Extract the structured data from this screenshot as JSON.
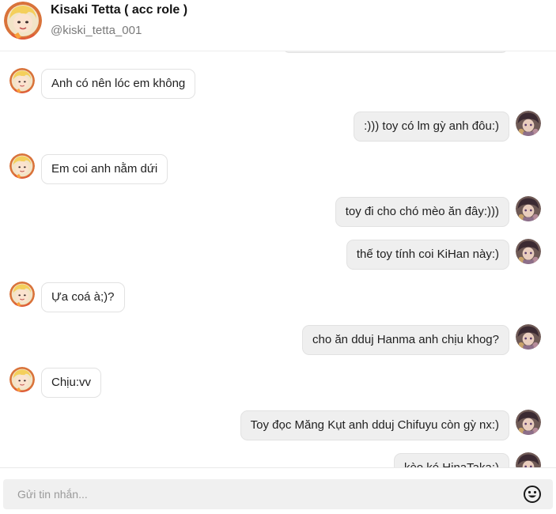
{
  "header": {
    "name": "Kisaki Tetta ( acc role )",
    "handle": "@kiski_tetta_001"
  },
  "composer": {
    "placeholder": "Gửi tin nhắn..."
  },
  "colors": {
    "incoming_bubble": "#ffffff",
    "outgoing_bubble": "#efefef",
    "bubble_border": "#e2e2e2",
    "composer_field": "#f0f0f0"
  },
  "icons": {
    "contact_avatar": "blonde-character-avatar",
    "user_avatar": "character-avatar",
    "emoji_button": "smiley-face-icon"
  },
  "messages": [
    {
      "side": "out",
      "text": ""
    },
    {
      "side": "in",
      "text": "Anh có nên lóc em không"
    },
    {
      "side": "out",
      "text": ":))) toy có lm gỳ anh đôu:)"
    },
    {
      "side": "in",
      "text": "Em coi anh nằm dứi"
    },
    {
      "side": "out",
      "text": "toy đi cho chó mèo ăn đây:)))"
    },
    {
      "side": "out",
      "text": "thế toy tính coi KiHan này:)"
    },
    {
      "side": "in",
      "text": "Ựa coá à;)?"
    },
    {
      "side": "out",
      "text": "cho ăn dduj Hanma anh chịu khog?"
    },
    {
      "side": "in",
      "text": "Chịu:vv"
    },
    {
      "side": "out",
      "text": "Toy đọc Măng Kụt anh dduj Chifuyu còn gỳ nx:)"
    },
    {
      "side": "out",
      "text": "kèo ké HinaTaka:)"
    }
  ]
}
